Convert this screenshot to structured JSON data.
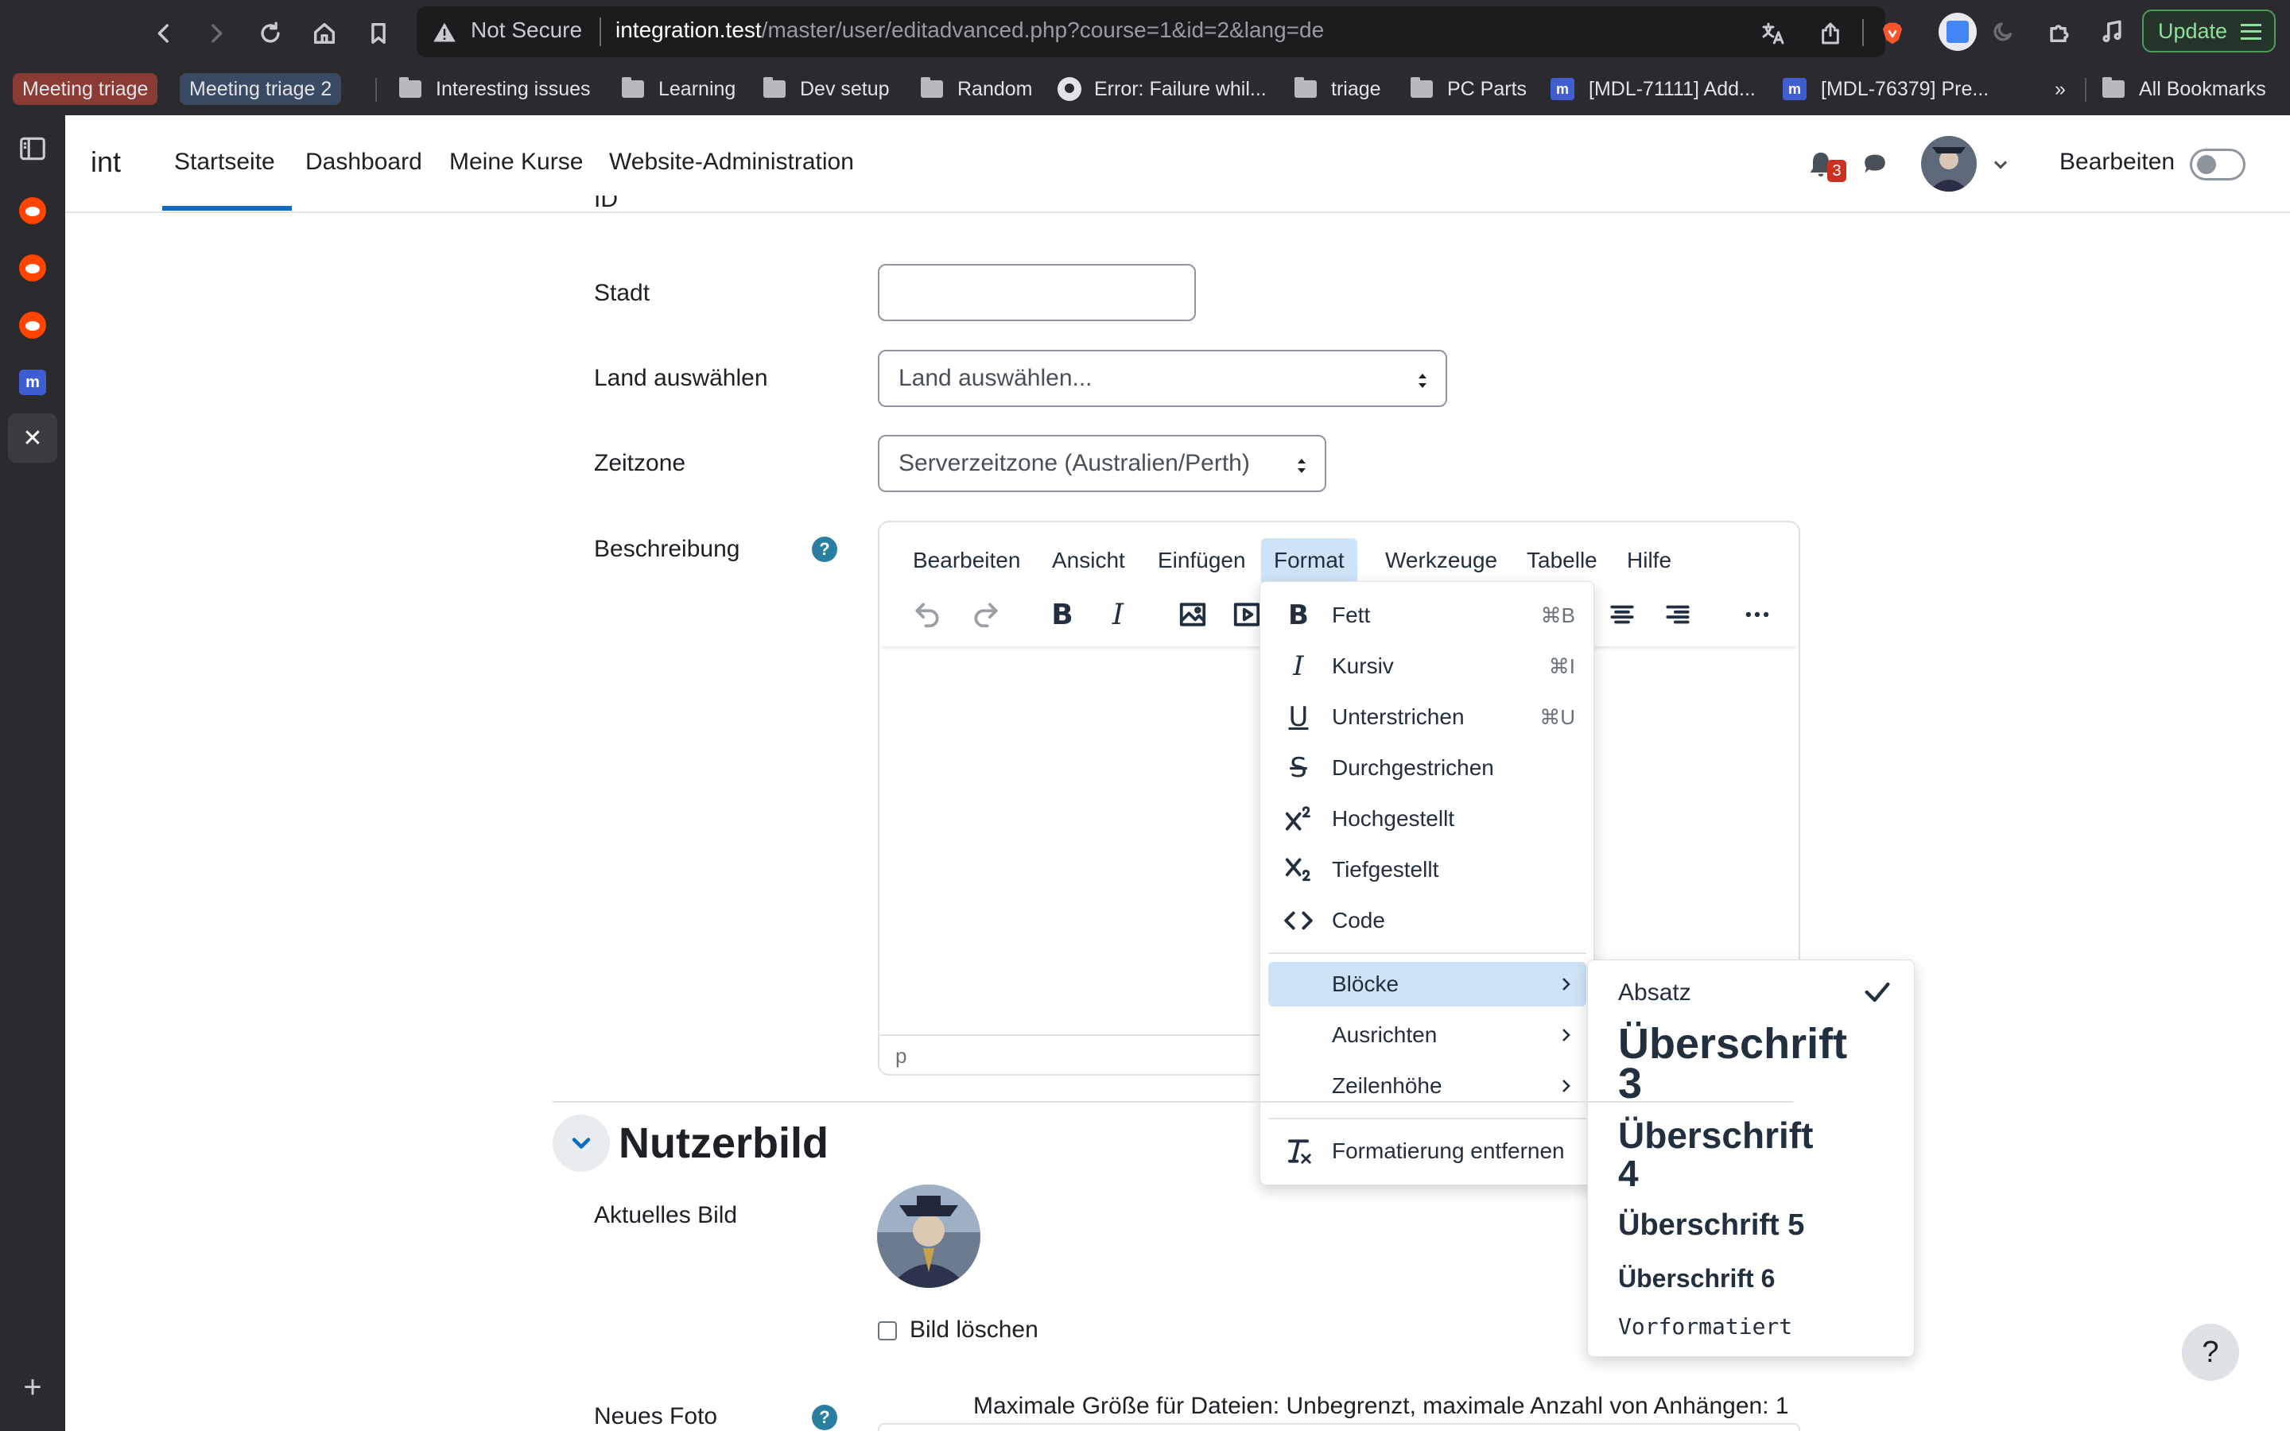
{
  "browser": {
    "security_label": "Not Secure",
    "url_host": "integration.test",
    "url_path": "/master/user/editadvanced.php?course=1&id=2&lang=de",
    "update_label": "Update",
    "bookmarks": [
      {
        "label": "Meeting triage",
        "color": "#8a3b33"
      },
      {
        "label": "Meeting triage 2",
        "color": "#3a4a63"
      },
      {
        "label": "Interesting issues",
        "icon": "folder-icon"
      },
      {
        "label": "Learning",
        "icon": "folder-icon"
      },
      {
        "label": "Dev setup",
        "icon": "folder-icon"
      },
      {
        "label": "Random",
        "icon": "folder-icon"
      },
      {
        "label": "Error: Failure whil...",
        "icon": "github-icon"
      },
      {
        "label": "triage",
        "icon": "folder-icon"
      },
      {
        "label": "PC Parts",
        "icon": "folder-icon"
      },
      {
        "label": "[MDL-71111] Add...",
        "icon": "moodle-icon"
      },
      {
        "label": "[MDL-76379] Pre...",
        "icon": "moodle-icon"
      },
      {
        "label": "»"
      },
      {
        "label": "All Bookmarks",
        "icon": "folder-icon"
      }
    ]
  },
  "navbar": {
    "brand": "int",
    "links": [
      "Startseite",
      "Dashboard",
      "Meine Kurse",
      "Website-Administration"
    ],
    "active_link": "Startseite",
    "notification_count": "3",
    "edit_mode_label": "Bearbeiten",
    "edit_mode_on": false
  },
  "form": {
    "id_label": "ID",
    "city_label": "Stadt",
    "city_value": "",
    "country_label": "Land auswählen",
    "country_value": "Land auswählen...",
    "timezone_label": "Zeitzone",
    "timezone_value": "Serverzeitzone (Australien/Perth)",
    "description_label": "Beschreibung",
    "help_glyph": "?"
  },
  "editor": {
    "menus": [
      "Bearbeiten",
      "Ansicht",
      "Einfügen",
      "Format",
      "Werkzeuge",
      "Tabelle",
      "Hilfe"
    ],
    "active_menu": "Format",
    "status_path": "p",
    "bold_glyph": "B",
    "italic_glyph": "I"
  },
  "format_menu": {
    "items": [
      {
        "label": "Fett",
        "shortcut": "⌘B",
        "icon": "bold-icon",
        "glyph": "B"
      },
      {
        "label": "Kursiv",
        "shortcut": "⌘I",
        "icon": "italic-icon",
        "glyph": "I"
      },
      {
        "label": "Unterstrichen",
        "shortcut": "⌘U",
        "icon": "underline-icon",
        "glyph": "U"
      },
      {
        "label": "Durchgestrichen",
        "shortcut": "",
        "icon": "strikethrough-icon",
        "glyph": "S"
      },
      {
        "label": "Hochgestellt",
        "shortcut": "",
        "icon": "superscript-icon"
      },
      {
        "label": "Tiefgestellt",
        "shortcut": "",
        "icon": "subscript-icon"
      },
      {
        "label": "Code",
        "shortcut": "",
        "icon": "code-icon"
      }
    ],
    "submenus": [
      {
        "label": "Blöcke",
        "highlighted": true
      },
      {
        "label": "Ausrichten",
        "highlighted": false
      },
      {
        "label": "Zeilenhöhe",
        "highlighted": false
      }
    ],
    "clear_label": "Formatierung entfernen"
  },
  "blocks_menu": {
    "items": [
      {
        "label": "Absatz",
        "selected": true
      },
      {
        "label_line1": "Überschrift",
        "label_line2": "3"
      },
      {
        "label_line1": "Überschrift",
        "label_line2": "4"
      },
      {
        "label": "Überschrift 5"
      },
      {
        "label": "Überschrift 6"
      },
      {
        "label": "Vorformatiert"
      }
    ]
  },
  "picture_section": {
    "title": "Nutzerbild",
    "current_label": "Aktuelles Bild",
    "delete_label": "Bild löschen",
    "new_photo_label": "Neues Foto",
    "max_size_text": "Maximale Größe für Dateien: Unbegrenzt, maximale Anzahl von Anhängen: 1"
  },
  "colors": {
    "accent": "#0f6cbf",
    "menu_highlight": "#cfe3f7",
    "help_icon": "#2a7fa0",
    "notification_badge": "#ca3120"
  }
}
